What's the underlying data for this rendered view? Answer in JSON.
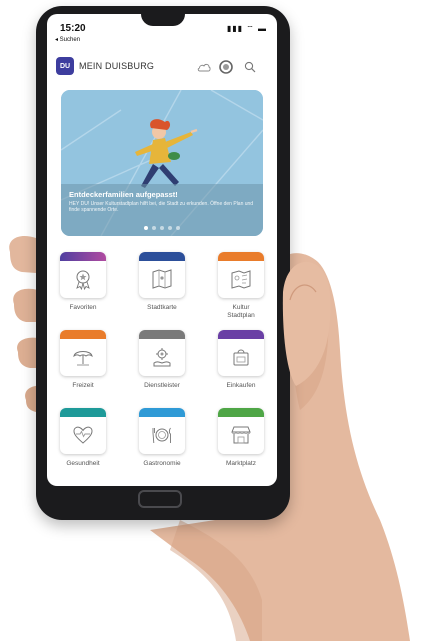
{
  "status_bar": {
    "time": "15:20",
    "back_label": "◂ Suchen",
    "icons": "▮▮▮ ⌔ ▬"
  },
  "app": {
    "logo_text": "DU",
    "title": "MEIN DUISBURG"
  },
  "banner": {
    "title": "Entdeckerfamilien aufgepasst!",
    "text": "HEY DU! Unser Kulturstadtplan hilft bei, die Stadt zu erkunden. Öffne den Plan und finde spannende Orte.",
    "slide_count": 5,
    "active_slide": 1
  },
  "tiles": [
    {
      "label": "Favoriten",
      "icon": "award-icon",
      "color": "#6a3fa5"
    },
    {
      "label": "Stadtkarte",
      "icon": "map-icon",
      "color": "#2c4f9a"
    },
    {
      "label": "Kultur\nStadtplan",
      "icon": "culture-map-icon",
      "color": "#e97c2b"
    },
    {
      "label": "Freizeit",
      "icon": "umbrella-icon",
      "color": "#e97c2b"
    },
    {
      "label": "Dienstleister",
      "icon": "service-gear-icon",
      "color": "#7a7a7a"
    },
    {
      "label": "Einkaufen",
      "icon": "shopping-icon",
      "color": "#6a3fa5"
    },
    {
      "label": "Gesundheit",
      "icon": "heart-pulse-icon",
      "color": "#1e9a99"
    },
    {
      "label": "Gastronomie",
      "icon": "plate-cutlery-icon",
      "color": "#2f9ad6"
    },
    {
      "label": "Marktplatz",
      "icon": "market-stall-icon",
      "color": "#4fa646"
    }
  ]
}
